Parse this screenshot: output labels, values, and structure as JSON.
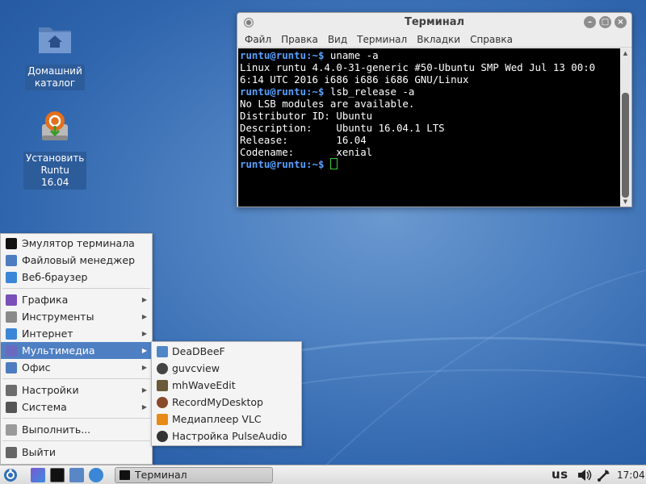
{
  "desktop": {
    "icons": [
      {
        "label_line1": "Домашний",
        "label_line2": "каталог",
        "icon": "home-folder-icon"
      },
      {
        "label_line1": "Установить",
        "label_line2": "Runtu 16.04",
        "icon": "installer-icon"
      }
    ]
  },
  "terminal": {
    "title": "Терминал",
    "menu": [
      "Файл",
      "Правка",
      "Вид",
      "Терминал",
      "Вкладки",
      "Справка"
    ],
    "prompt": "runtu@runtu:~$",
    "lines": [
      {
        "prompt": true,
        "text": " uname -a"
      },
      {
        "prompt": false,
        "text": "Linux runtu 4.4.0-31-generic #50-Ubuntu SMP Wed Jul 13 00:0"
      },
      {
        "prompt": false,
        "text": "6:14 UTC 2016 i686 i686 i686 GNU/Linux"
      },
      {
        "prompt": true,
        "text": " lsb_release -a"
      },
      {
        "prompt": false,
        "text": "No LSB modules are available."
      },
      {
        "prompt": false,
        "text": "Distributor ID: Ubuntu"
      },
      {
        "prompt": false,
        "text": "Description:    Ubuntu 16.04.1 LTS"
      },
      {
        "prompt": false,
        "text": "Release:        16.04"
      },
      {
        "prompt": false,
        "text": "Codename:       xenial"
      },
      {
        "prompt": true,
        "text": " "
      }
    ],
    "colors": {
      "prompt": "#58a0ff",
      "cursor": "#33cc33",
      "bg": "#000000"
    }
  },
  "main_menu": {
    "items": [
      {
        "label": "Эмулятор терминала",
        "icon": "terminal-icon",
        "submenu": false,
        "color": "#111111"
      },
      {
        "label": "Файловый менеджер",
        "icon": "folder-icon",
        "submenu": false,
        "color": "#4d7cc0"
      },
      {
        "label": "Веб-браузер",
        "icon": "browser-icon",
        "submenu": false,
        "color": "#3b86d6"
      },
      {
        "label": "Графика",
        "icon": "graphics-icon",
        "submenu": true,
        "color": "#7a4fb8"
      },
      {
        "label": "Инструменты",
        "icon": "tools-icon",
        "submenu": true,
        "color": "#8a8a8a"
      },
      {
        "label": "Интернет",
        "icon": "internet-icon",
        "submenu": true,
        "color": "#3b86d6"
      },
      {
        "label": "Мультимедиа",
        "icon": "multimedia-icon",
        "submenu": true,
        "color": "#6a6ac0",
        "highlighted": true
      },
      {
        "label": "Офис",
        "icon": "office-icon",
        "submenu": true,
        "color": "#4d7cc0"
      },
      {
        "label": "Настройки",
        "icon": "settings-icon",
        "submenu": true,
        "color": "#6c6c6c"
      },
      {
        "label": "Система",
        "icon": "system-icon",
        "submenu": true,
        "color": "#555555"
      },
      {
        "label": "Выполнить...",
        "icon": "run-icon",
        "submenu": false,
        "color": "#9a9a9a"
      },
      {
        "label": "Выйти",
        "icon": "logout-icon",
        "submenu": false,
        "color": "#666666"
      }
    ]
  },
  "multimedia_submenu": {
    "items": [
      {
        "label": "DeaDBeeF",
        "icon": "music-note-icon",
        "color": "#4f86c8"
      },
      {
        "label": "guvcview",
        "icon": "webcam-icon",
        "color": "#444444"
      },
      {
        "label": "mhWaveEdit",
        "icon": "waveform-icon",
        "color": "#6a5a3a"
      },
      {
        "label": "RecordMyDesktop",
        "icon": "record-icon",
        "color": "#8a4a2a"
      },
      {
        "label": "Медиаплеер VLC",
        "icon": "vlc-icon",
        "color": "#e88a18"
      },
      {
        "label": "Настройка PulseAudio",
        "icon": "pulseaudio-icon",
        "color": "#333333"
      }
    ]
  },
  "taskbar": {
    "task_label": "Терминал",
    "keyboard_layout": "us",
    "clock": "17:04",
    "launchers": [
      "menu-icon",
      "graphics-icon",
      "terminal-icon",
      "folder-icon",
      "browser-icon"
    ]
  }
}
